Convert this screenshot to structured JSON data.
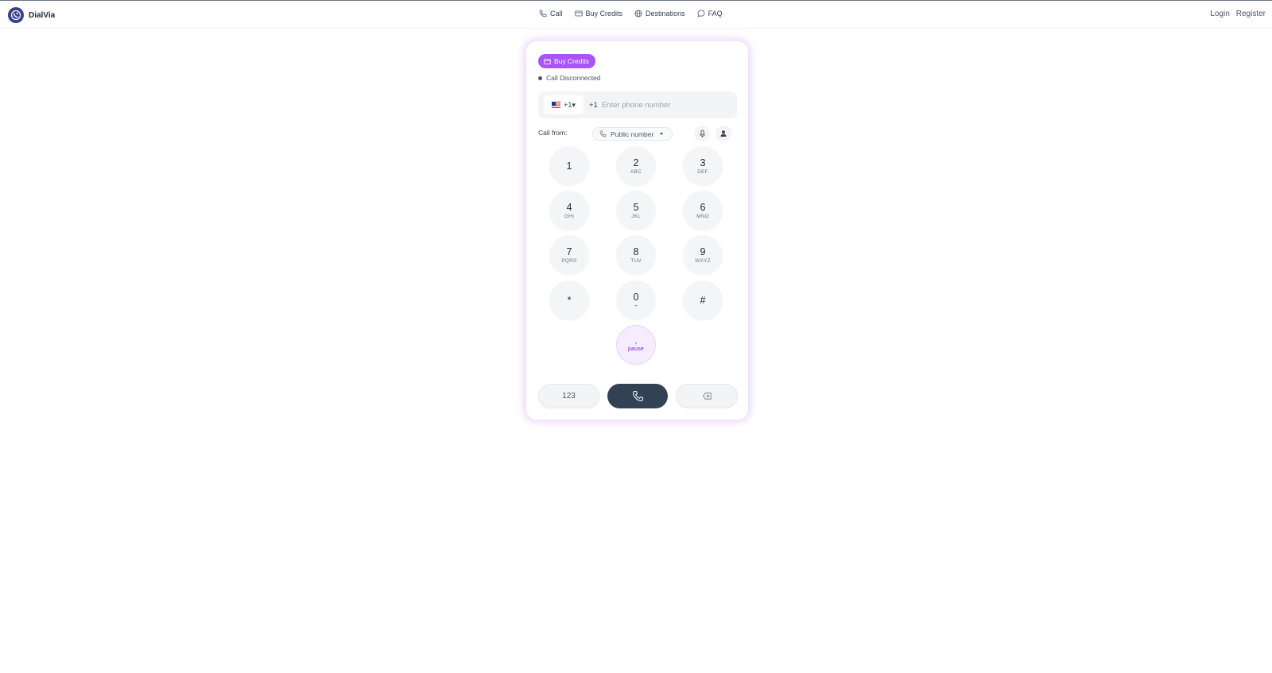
{
  "app": {
    "name": "DialVia"
  },
  "nav": [
    {
      "label": "Call",
      "icon": "phone-icon"
    },
    {
      "label": "Buy Credits",
      "icon": "credit-card-icon"
    },
    {
      "label": "Destinations",
      "icon": "globe-icon"
    },
    {
      "label": "FAQ",
      "icon": "chat-bubble-icon"
    }
  ],
  "auth": {
    "login": "Login",
    "register": "Register"
  },
  "dialer": {
    "buy_credits": "Buy Credits",
    "status": "Call Disconnected",
    "country_code": "+1▾",
    "prefix": "+1",
    "phone_value": "",
    "phone_placeholder": "Enter phone number",
    "call_from_label": "Call from:",
    "call_from_value": "Public number",
    "keys": [
      {
        "digit": "1",
        "letters": ""
      },
      {
        "digit": "2",
        "letters": "ABC"
      },
      {
        "digit": "3",
        "letters": "DEF"
      },
      {
        "digit": "4",
        "letters": "GHI"
      },
      {
        "digit": "5",
        "letters": "JKL"
      },
      {
        "digit": "6",
        "letters": "MNO"
      },
      {
        "digit": "7",
        "letters": "PQRS"
      },
      {
        "digit": "8",
        "letters": "TUV"
      },
      {
        "digit": "9",
        "letters": "WXYZ"
      },
      {
        "digit": "*",
        "letters": ""
      },
      {
        "digit": "0",
        "letters": "+"
      },
      {
        "digit": "#",
        "letters": ""
      }
    ],
    "pause_key": {
      "digit": ",",
      "letters": "pause"
    },
    "keypad_toggle": "123"
  },
  "colors": {
    "accent": "#a855f7",
    "call_button": "#334155",
    "logo": "#3b3f8f"
  }
}
